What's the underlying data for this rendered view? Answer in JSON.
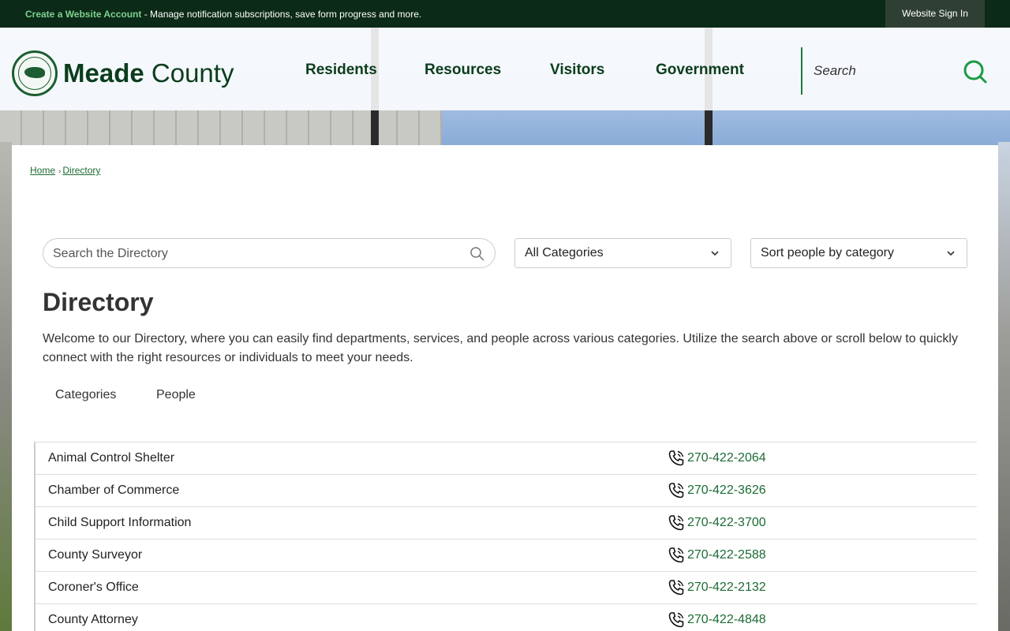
{
  "topbar": {
    "create_account_link": "Create a Website Account",
    "create_account_desc": " - Manage notification subscriptions, save form progress and more.",
    "sign_in_label": "Website Sign In"
  },
  "header": {
    "logo_bold": "Meade",
    "logo_regular": " County",
    "nav": [
      "Residents",
      "Resources",
      "Visitors",
      "Government"
    ],
    "search_placeholder": "Search",
    "accent_color": "#1c7a3a"
  },
  "breadcrumb": [
    "Home",
    "Directory"
  ],
  "directory": {
    "search_placeholder": "Search the Directory",
    "category_select": "All Categories",
    "sort_select": "Sort people by category",
    "title": "Directory",
    "intro": "Welcome to our Directory, where you can easily find departments, services, and people across various categories. Utilize the search above or scroll below to quickly connect with the right resources or individuals to meet your needs.",
    "tabs": [
      "Categories",
      "People"
    ],
    "entries": [
      {
        "name": "Animal Control Shelter",
        "phone": "270-422-2064"
      },
      {
        "name": "Chamber of Commerce",
        "phone": "270-422-3626"
      },
      {
        "name": "Child Support Information",
        "phone": "270-422-3700"
      },
      {
        "name": "County Surveyor",
        "phone": "270-422-2588"
      },
      {
        "name": "Coroner's Office",
        "phone": "270-422-2132"
      },
      {
        "name": "County Attorney",
        "phone": "270-422-4848"
      }
    ]
  }
}
